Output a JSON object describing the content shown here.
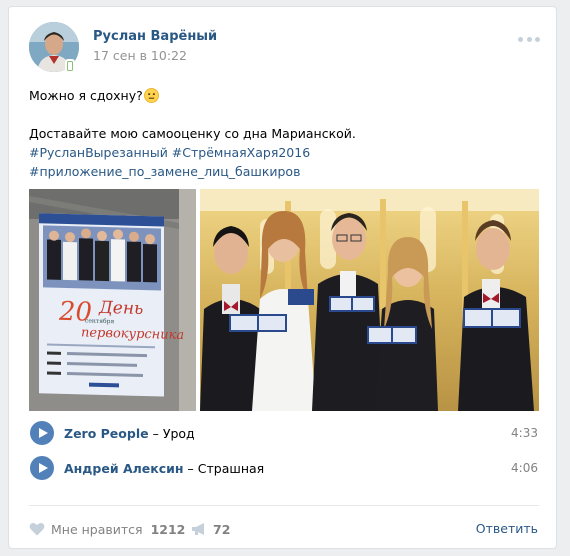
{
  "post": {
    "author": "Руслан Варёный",
    "date": "17 сен в 10:22",
    "text": {
      "line1": "Можно я сдохну?",
      "line2": "Доставайте мою самооценку со дна Марианской.",
      "hashtags_line1": "#РусланВырезанный #СтрёмнаяХаря2016",
      "hashtags_line2": "#приложение_по_замене_лиц_башкиров"
    },
    "poster": {
      "big_number": "20",
      "script_text": "День",
      "month": "сентября",
      "subtitle": "первокурсника"
    }
  },
  "audio": [
    {
      "artist": "Zero People",
      "separator": "–",
      "title": "Урод",
      "duration": "4:33"
    },
    {
      "artist": "Андрей Алексин",
      "separator": "–",
      "title": "Страшная",
      "duration": "4:06"
    }
  ],
  "footer": {
    "like_label": "Мне нравится",
    "like_count": "1212",
    "share_count": "72",
    "reply_label": "Ответить"
  },
  "colors": {
    "link": "#2a5885",
    "accent": "#5181b8",
    "muted": "#828282"
  }
}
